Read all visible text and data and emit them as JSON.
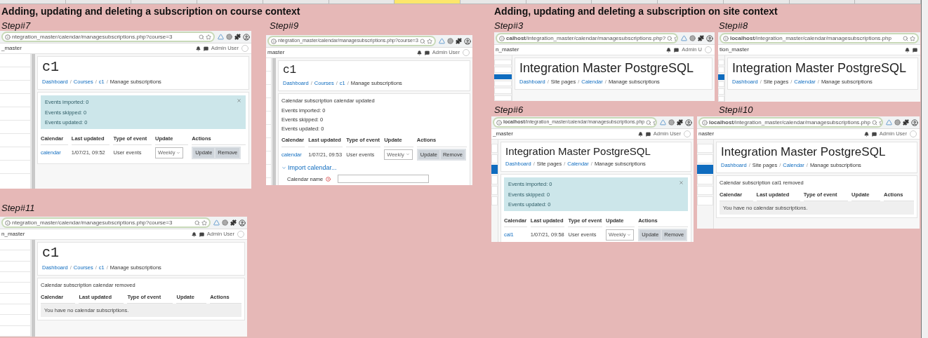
{
  "column_headers": [
    {
      "selected": false
    },
    {
      "selected": false
    },
    {
      "selected": false
    },
    {
      "selected": false
    },
    {
      "selected": false
    },
    {
      "selected": false
    },
    {
      "selected": true
    },
    {
      "selected": false
    },
    {
      "selected": false
    },
    {
      "selected": false
    },
    {
      "selected": false
    },
    {
      "selected": false
    },
    {
      "selected": false
    },
    {
      "selected": false
    }
  ],
  "sections": [
    {
      "heading": "Adding, updating and deleting a subscription on course context",
      "steps": [
        {
          "label": "Step#7",
          "screenshot": {
            "kind": "course",
            "url": "ntegration_master/calendar/managesubscriptions.php?course=3",
            "extensions": true,
            "site_name": "_master",
            "user": "Admin User",
            "title": "c1",
            "breadcrumb_separator": "/",
            "breadcrumb": [
              {
                "text": "Dashboard",
                "link": true
              },
              {
                "text": "Courses",
                "link": true
              },
              {
                "text": "c1",
                "link": true
              },
              {
                "text": "Manage subscriptions",
                "link": false
              }
            ],
            "notice": [
              "Events imported: 0",
              "Events skipped: 0",
              "Events updated: 0"
            ],
            "table": {
              "columns": [
                "Calendar",
                "Last updated",
                "Type of event",
                "Update",
                "Actions"
              ],
              "rows": [
                {
                  "calendar": "calendar",
                  "last_updated": "1/07/21, 09:52",
                  "type": "User events",
                  "update": "Weekly",
                  "actions": [
                    "Update",
                    "Remove"
                  ]
                }
              ]
            }
          }
        },
        {
          "label": "Step#9",
          "screenshot": {
            "kind": "course",
            "url": "ntegration_master/calendar/managesubscriptions.php?course=3",
            "extensions": true,
            "site_name": "master",
            "user": "Admin User",
            "title": "c1",
            "breadcrumb_separator": "/",
            "breadcrumb": [
              {
                "text": "Dashboard",
                "link": true
              },
              {
                "text": "Courses",
                "link": true
              },
              {
                "text": "c1",
                "link": true
              },
              {
                "text": "Manage subscriptions",
                "link": false
              }
            ],
            "messages": [
              "Calendar subscription calendar updated",
              "Events imported: 0",
              "Events skipped: 0",
              "Events updated: 0"
            ],
            "table": {
              "columns": [
                "Calendar",
                "Last updated",
                "Type of event",
                "Update",
                "Actions"
              ],
              "rows": [
                {
                  "calendar": "calendar",
                  "last_updated": "1/07/21, 09:53",
                  "type": "User events",
                  "update": "Weekly",
                  "actions": [
                    "Update",
                    "Remove"
                  ]
                }
              ]
            },
            "import": {
              "link": "Import calendar...",
              "field_label": "Calendar name"
            }
          }
        },
        {
          "label": "Step#11",
          "screenshot": {
            "kind": "course",
            "url": "ntegration_master/calendar/managesubscriptions.php?course=3",
            "extensions": true,
            "site_name": "n_master",
            "user": "Admin User",
            "title": "c1",
            "breadcrumb_separator": "/",
            "breadcrumb": [
              {
                "text": "Dashboard",
                "link": true
              },
              {
                "text": "Courses",
                "link": true
              },
              {
                "text": "c1",
                "link": true
              },
              {
                "text": "Manage subscriptions",
                "link": false
              }
            ],
            "messages": [
              "Calendar subscription calendar removed"
            ],
            "table": {
              "columns": [
                "Calendar",
                "Last updated",
                "Type of event",
                "Update",
                "Actions"
              ],
              "empty_message": "You have no calendar subscriptions."
            }
          }
        }
      ]
    },
    {
      "heading": "Adding, updating and deleting a subscription on site context",
      "steps": [
        {
          "label": "Step#3",
          "screenshot": {
            "kind": "site",
            "url": "**calhost**/integration_master/calendar/managesubscriptions.php?",
            "extensions": true,
            "site_name": "n_master",
            "user": "Admin U",
            "title": "Integration Master PostgreSQL",
            "breadcrumb_separator": "/",
            "breadcrumb": [
              {
                "text": "Dashboard",
                "link": true
              },
              {
                "text": "Site pages",
                "link": false
              },
              {
                "text": "Calendar",
                "link": true
              },
              {
                "text": "Manage subscriptions",
                "link": false
              }
            ]
          }
        },
        {
          "label": "Step#8",
          "screenshot": {
            "kind": "site",
            "url": "**localhost**/integration_master/calendar/managesubscriptions.php",
            "extensions": false,
            "site_name": "tion_master",
            "title": "Integration Master PostgreSQL",
            "breadcrumb_separator": "/",
            "breadcrumb": [
              {
                "text": "Dashboard",
                "link": true
              },
              {
                "text": "Site pages",
                "link": false
              },
              {
                "text": "Calendar",
                "link": true
              },
              {
                "text": "Manage subscriptions",
                "link": false
              }
            ]
          }
        },
        {
          "label": "Step#6",
          "screenshot": {
            "kind": "site",
            "url": "**localhost**/integration_master/calendar/managesubscriptions.php",
            "extensions": true,
            "site_name": "_master",
            "user": "Admin User",
            "title": "Integration Master PostgreSQL",
            "breadcrumb_separator": "/",
            "breadcrumb": [
              {
                "text": "Dashboard",
                "link": true
              },
              {
                "text": "Site pages",
                "link": false
              },
              {
                "text": "Calendar",
                "link": true
              },
              {
                "text": "Manage subscriptions",
                "link": false
              }
            ],
            "notice": [
              "Events imported: 0",
              "Events skipped: 0",
              "Events updated: 0"
            ],
            "table": {
              "columns": [
                "Calendar",
                "Last updated",
                "Type of event",
                "Update",
                "Actions"
              ],
              "rows": [
                {
                  "calendar": "cal1",
                  "last_updated": "1/07/21, 09:58",
                  "type": "User events",
                  "update": "Weekly",
                  "actions": [
                    "Update",
                    "Remove"
                  ]
                }
              ]
            }
          }
        },
        {
          "label": "Step#10",
          "screenshot": {
            "kind": "site",
            "url": "**localhost**/integration_master/calendar/managesubscriptions.php",
            "extensions": true,
            "site_name": "naster",
            "user": "Admin User",
            "title": "Integration Master PostgreSQL",
            "breadcrumb_separator": "/",
            "breadcrumb": [
              {
                "text": "Dashboard",
                "link": true
              },
              {
                "text": "Site pages",
                "link": false
              },
              {
                "text": "Calendar",
                "link": true
              },
              {
                "text": "Manage subscriptions",
                "link": false
              }
            ],
            "messages": [
              "Calendar subscription cal1 removed"
            ],
            "table": {
              "columns": [
                "Calendar",
                "Last updated",
                "Type of event",
                "Update",
                "Actions"
              ],
              "empty_message": "You have no calendar subscriptions."
            }
          }
        }
      ]
    }
  ]
}
